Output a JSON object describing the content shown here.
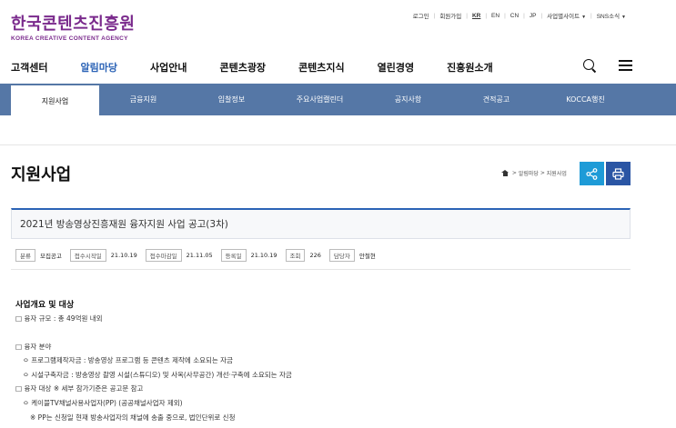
{
  "header": {
    "logo_ko": "한국콘텐츠진흥원",
    "logo_en": "KOREA CREATIVE CONTENT AGENCY",
    "util_links": [
      "로그인",
      "회원가입",
      "KR",
      "EN",
      "CN",
      "JP",
      "사업별사이트",
      "SNS소식"
    ]
  },
  "gnb": {
    "items": [
      "고객센터",
      "알림마당",
      "사업안내",
      "콘텐츠광장",
      "콘텐츠지식",
      "열린경영",
      "진흥원소개"
    ],
    "active": "알림마당"
  },
  "subnav": {
    "tabs": [
      "지원사업",
      "금융지원",
      "입찰정보",
      "주요사업캘린더",
      "공지사항",
      "견적공고",
      "KOCCA행진"
    ],
    "active": "지원사업"
  },
  "page": {
    "title": "지원사업",
    "breadcrumb": [
      "알림마당",
      "지원사업"
    ]
  },
  "post": {
    "title": "2021년 방송영상진흥재원 융자지원 사업 공고(3차)",
    "meta": [
      {
        "label": "분류",
        "value": "모집공고"
      },
      {
        "label": "접수시작일",
        "value": "21.10.19"
      },
      {
        "label": "접수마감일",
        "value": "21.11.05"
      },
      {
        "label": "등록일",
        "value": "21.10.19"
      },
      {
        "label": "조회",
        "value": "226"
      },
      {
        "label": "담당자",
        "value": "안철현"
      }
    ]
  },
  "content": {
    "heading": "사업개요 및 대상",
    "lines": [
      "□ 융자 규모 : 총 49억원 내외",
      "□ 융자 분야",
      "ㅇ 프로그램제작자금 : 방송영상 프로그램 등 콘텐츠 제작에 소요되는 자금",
      "ㅇ 시설구축자금 : 방송영상 촬영 시설(스튜디오) 및 사옥(사무공간) 개선·구축에 소요되는 자금",
      "□ 융자 대상 ※ 세부 참가기준은 공고문 참고",
      "ㅇ 케이블TV채널사용사업자(PP) (공공채널사업자 제외)",
      "※ PP는 신청일 현재 방송사업자의 채널에 송출 중으로, 법인단위로 신청"
    ]
  }
}
